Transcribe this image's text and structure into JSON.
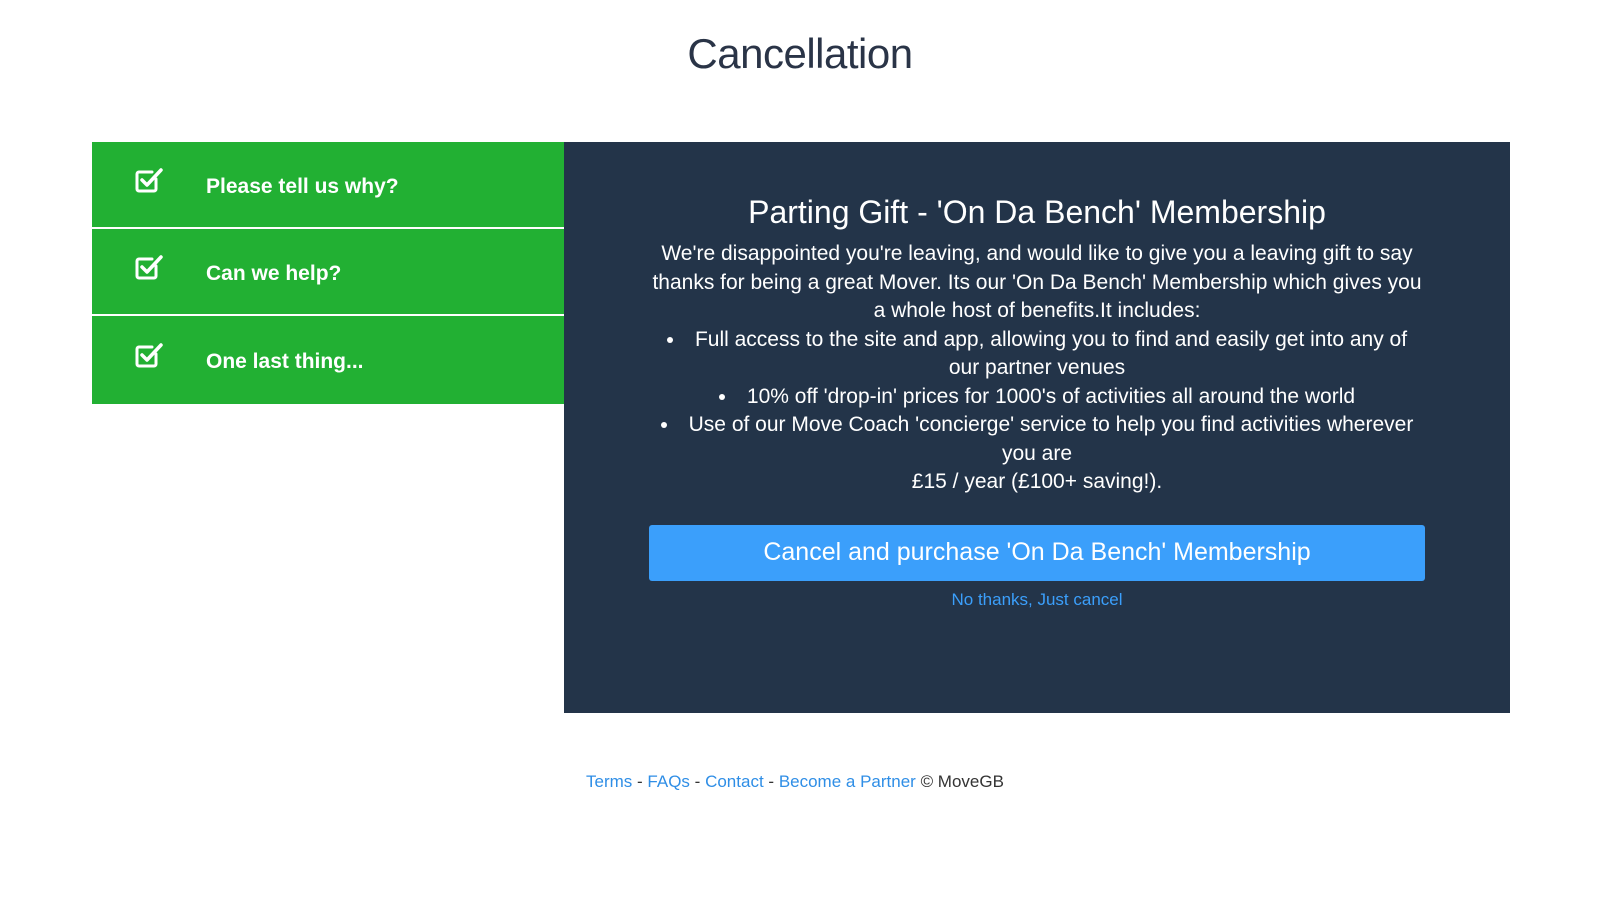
{
  "page": {
    "title": "Cancellation"
  },
  "steps": [
    {
      "icon": "checkbox-checked-icon",
      "label": "Please tell us why?"
    },
    {
      "icon": "checkbox-checked-icon",
      "label": "Can we help?"
    },
    {
      "icon": "checkbox-checked-icon",
      "label": "One last thing..."
    }
  ],
  "offer": {
    "heading": "Parting Gift - 'On Da Bench' Membership",
    "description": "We're disappointed you're leaving, and would like to give you a leaving gift to say thanks for being a great Mover. Its our 'On Da Bench' Membership which gives you a whole host of benefits.It includes:",
    "benefits": [
      "Full access to the site and app, allowing you to find and easily get into any of our partner venues",
      "10% off 'drop-in' prices for 1000's of activities all around the world",
      "Use of our Move Coach 'concierge' service to help you find activities wherever you are"
    ],
    "price": "£15 / year (£100+ saving!).",
    "cta_label": "Cancel and purchase 'On Da Bench' Membership",
    "decline_label": "No thanks, Just cancel"
  },
  "footer": {
    "links": [
      "Terms",
      "FAQs",
      "Contact",
      "Become a Partner"
    ],
    "separator": "-",
    "copyright": "© MoveGB"
  },
  "colors": {
    "step_green": "#22b033",
    "panel_navy": "#233449",
    "accent_blue": "#3b9ffb"
  }
}
